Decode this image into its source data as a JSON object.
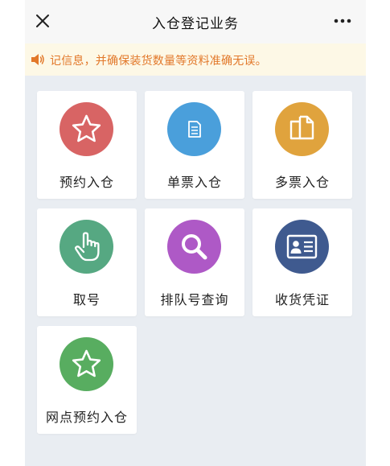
{
  "header": {
    "title": "入仓登记业务",
    "close_icon": "close-icon",
    "more_icon": "more-icon"
  },
  "notice": {
    "icon": "speaker-icon",
    "text": "记信息，并确保装货数量等资料准确无误。"
  },
  "services": [
    {
      "label": "预约入仓",
      "icon": "star-icon",
      "color": "#d86464"
    },
    {
      "label": "单票入仓",
      "icon": "document-icon",
      "color": "#4a9fdb"
    },
    {
      "label": "多票入仓",
      "icon": "documents-icon",
      "color": "#e0a33d"
    },
    {
      "label": "取号",
      "icon": "hand-pointer-icon",
      "color": "#56a882"
    },
    {
      "label": "排队号查询",
      "icon": "search-icon",
      "color": "#ae59c6"
    },
    {
      "label": "收货凭证",
      "icon": "id-card-icon",
      "color": "#3f5a8f"
    },
    {
      "label": "网点预约入仓",
      "icon": "star-icon",
      "color": "#58ad60"
    }
  ]
}
